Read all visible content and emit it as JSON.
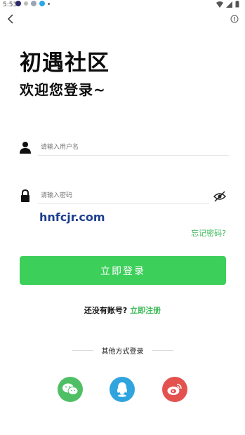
{
  "status_bar": {
    "time": "5:53"
  },
  "header": {
    "title": "初遇社区",
    "subtitle": "欢迎您登录~"
  },
  "form": {
    "username_placeholder": "请输入用户名",
    "password_placeholder": "请输入密码",
    "captcha_text": "hnfcjr.com",
    "forgot_label": "忘记密码?",
    "login_label": "立即登录"
  },
  "register": {
    "prompt": "还没有账号?",
    "link": "立即注册"
  },
  "other_login": {
    "label": "其他方式登录",
    "options": [
      "wechat",
      "qq",
      "weibo"
    ]
  },
  "colors": {
    "accent": "#3ccf5a",
    "link": "#3dba58",
    "wechat": "#4fbf66",
    "qq": "#2fa4de",
    "weibo": "#e45250"
  }
}
